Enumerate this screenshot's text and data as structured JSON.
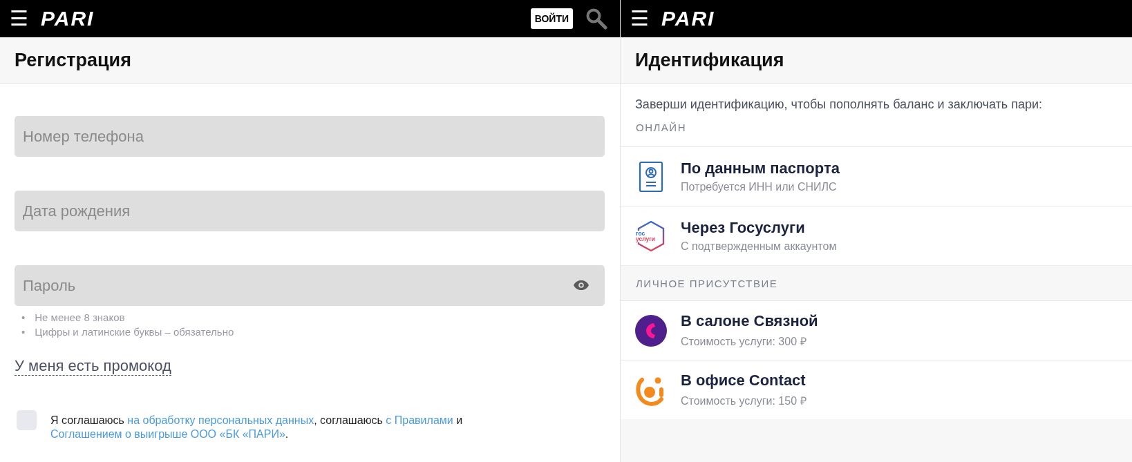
{
  "left": {
    "header": {
      "menu_glyph": "☰",
      "logo": "PARI",
      "login_button": "ВОЙТИ"
    },
    "title": "Регистрация",
    "fields": [
      {
        "kind": "text",
        "placeholder": "Номер телефона"
      },
      {
        "kind": "text",
        "placeholder": "Дата рождения"
      },
      {
        "kind": "password",
        "placeholder": "Пароль"
      }
    ],
    "password_hints": [
      {
        "marker": "•",
        "text": "Не менее 8 знаков"
      },
      {
        "marker": "•",
        "text": "Цифры и латинские буквы – обязательно"
      }
    ],
    "promo_link": "У меня есть промокод",
    "consent": {
      "checked": false,
      "parts": [
        {
          "kind": "text",
          "text": "Я соглашаюсь "
        },
        {
          "kind": "link",
          "text": "на обработку персональных данных"
        },
        {
          "kind": "text",
          "text": ", соглашаюсь "
        },
        {
          "kind": "link",
          "text": "с Правилами"
        },
        {
          "kind": "text",
          "text": " и "
        },
        {
          "kind": "link",
          "text": "Соглашением о выигрыше ООО «БК «ПАРИ»"
        },
        {
          "kind": "text",
          "text": "."
        }
      ]
    }
  },
  "right": {
    "header": {
      "menu_glyph": "☰",
      "logo": "PARI"
    },
    "title": "Идентификация",
    "intro": "Заверши идентификацию, чтобы пополнять баланс и заключать пари:",
    "sections": [
      {
        "heading": "ОНЛАЙН",
        "items": [
          {
            "kind": "passport",
            "title": "По данным паспорта",
            "subtitle": "Потребуется ИНН или СНИЛС"
          },
          {
            "kind": "gosuslugi",
            "title": "Через Госуслуги",
            "subtitle": "С подтвержденным аккаунтом",
            "logo_text": [
              "гос",
              "услуги"
            ]
          }
        ]
      },
      {
        "heading": "ЛИЧНОЕ ПРИСУТСТВИЕ",
        "items": [
          {
            "kind": "svyaznoy",
            "title": "В салоне Связной",
            "subtitle": "Стоимость услуги: 300 ₽"
          },
          {
            "kind": "contact",
            "title": "В офисе Contact",
            "subtitle": "Стоимость услуги: 150 ₽"
          }
        ]
      }
    ]
  }
}
